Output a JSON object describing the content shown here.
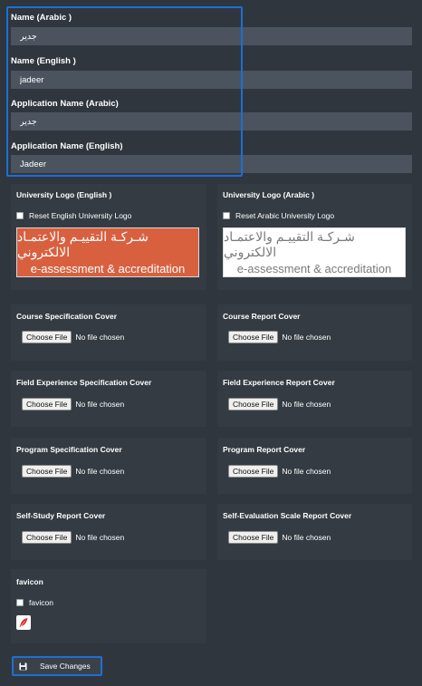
{
  "names": {
    "name_ar_label": "Name (Arabic )",
    "name_ar_value": "جدير",
    "name_en_label": "Name (English )",
    "name_en_value": "jadeer",
    "app_ar_label": "Application Name (Arabic)",
    "app_ar_value": "جدير",
    "app_en_label": "Application Name (English)",
    "app_en_value": "Jadeer"
  },
  "logos": {
    "en_title": "University Logo (English )",
    "en_reset": "Reset English University Logo",
    "ar_title": "University Logo (Arabic )",
    "ar_reset": "Reset Arabic University Logo",
    "logo_arabic_text": "شـركـة التقييـم والاعتمـاد الالكتروني",
    "logo_english_text": "e-assessment & accreditation",
    "en_logo_bg": "#d8603f",
    "ar_logo_bg": "#ffffff"
  },
  "covers": [
    {
      "title": "Course Specification Cover",
      "button": "Choose File",
      "status": "No file chosen"
    },
    {
      "title": "Course Report Cover",
      "button": "Choose File",
      "status": "No file chosen"
    },
    {
      "title": "Field Experience Specification Cover",
      "button": "Choose File",
      "status": "No file chosen"
    },
    {
      "title": "Field Experience Report Cover",
      "button": "Choose File",
      "status": "No file chosen"
    },
    {
      "title": "Program Specification Cover",
      "button": "Choose File",
      "status": "No file chosen"
    },
    {
      "title": "Program Report Cover",
      "button": "Choose File",
      "status": "No file chosen"
    },
    {
      "title": "Self-Study Report Cover",
      "button": "Choose File",
      "status": "No file chosen"
    },
    {
      "title": "Self-Evaluation Scale Report Cover",
      "button": "Choose File",
      "status": "No file chosen"
    }
  ],
  "favicon": {
    "title": "favicon",
    "checkbox_label": "favicon",
    "icon": "feather-icon"
  },
  "actions": {
    "save_label": "Save Changes",
    "save_icon": "floppy-disk-icon"
  },
  "colors": {
    "background": "#30363e",
    "input_bg": "#4b545e",
    "highlight": "#1d6fd6",
    "brand_orange": "#d8603f"
  }
}
